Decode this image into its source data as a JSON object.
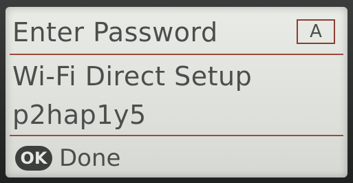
{
  "screen": {
    "title": "Enter Password",
    "input_mode": "A",
    "network_label": "Wi-Fi Direct Setup",
    "password_value": "p2hap1y5"
  },
  "footer": {
    "ok_key_label": "OK",
    "action_label": "Done"
  },
  "colors": {
    "lcd_background": "#e2e5df",
    "text": "#4a4f4b",
    "divider": "#9b4a3e",
    "ok_key": "#3b403c"
  }
}
